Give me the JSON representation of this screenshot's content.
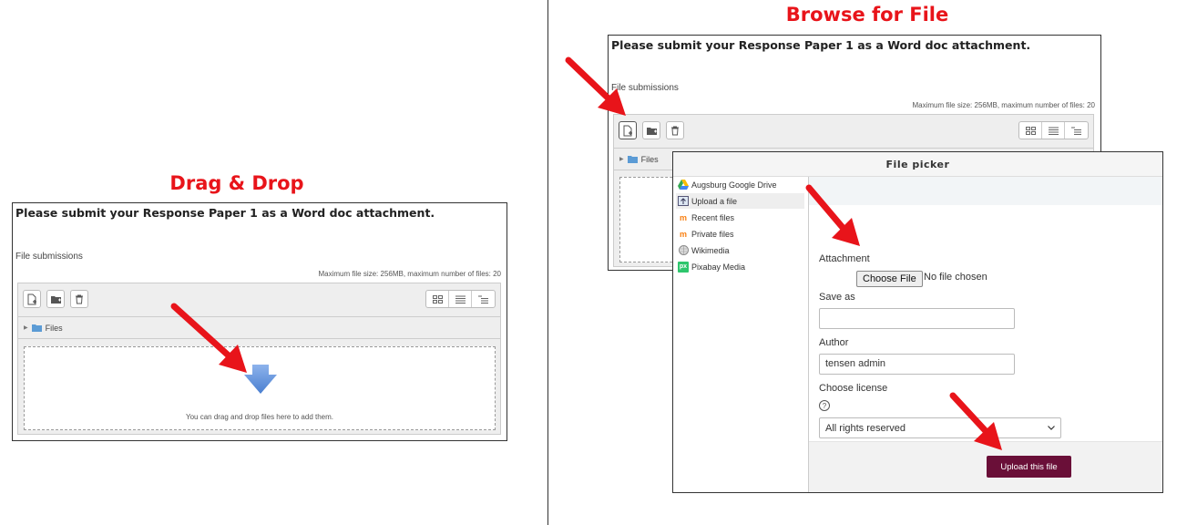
{
  "left": {
    "heading": "Drag & Drop",
    "panel": {
      "title": "Please submit your Response Paper 1 as a Word doc attachment.",
      "file_submissions_label": "File submissions",
      "max_size_text": "Maximum file size: 256MB, maximum number of files: 20",
      "files_label": "Files",
      "drop_text": "You can drag and drop files here to add them."
    }
  },
  "right": {
    "heading": "Browse for File",
    "panel": {
      "title": "Please submit your Response Paper 1 as a Word doc attachment.",
      "file_submissions_label": "File submissions",
      "max_size_text": "Maximum file size: 256MB, maximum number of files: 20",
      "files_label": "Files"
    },
    "file_picker": {
      "title": "File picker",
      "repositories": [
        {
          "label": "Augsburg Google Drive",
          "icon": "google-drive-icon"
        },
        {
          "label": "Upload a file",
          "icon": "upload-icon",
          "active": true
        },
        {
          "label": "Recent files",
          "icon": "moodle-recent-icon"
        },
        {
          "label": "Private files",
          "icon": "moodle-private-icon"
        },
        {
          "label": "Wikimedia",
          "icon": "wikimedia-icon"
        },
        {
          "label": "Pixabay Media",
          "icon": "pixabay-icon"
        }
      ],
      "attachment_label": "Attachment",
      "choose_file_button": "Choose File",
      "no_file_text": "No file chosen",
      "save_as_label": "Save as",
      "save_as_value": "",
      "author_label": "Author",
      "author_value": "tensen admin",
      "license_label": "Choose license",
      "help_icon_glyph": "?",
      "license_value": "All rights reserved",
      "upload_button": "Upload this file"
    }
  },
  "colors": {
    "heading_red": "#e8141a",
    "arrow_red": "#e8141a",
    "upload_button": "#6a0f38",
    "drop_arrow_blue": "#5b8fd9"
  }
}
